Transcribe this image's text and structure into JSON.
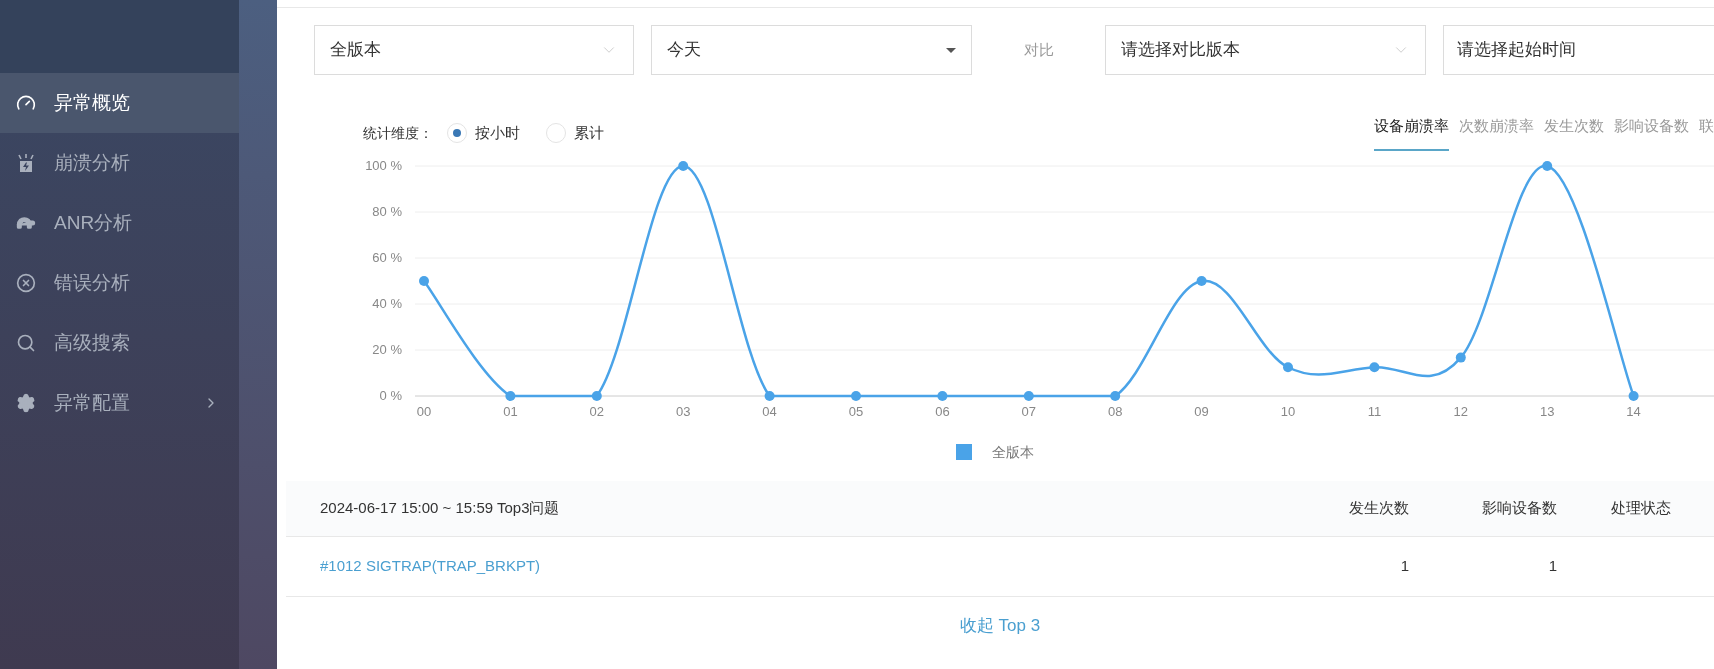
{
  "sidebar": {
    "items": [
      {
        "label": "异常概览",
        "selected": true,
        "has_submenu": false
      },
      {
        "label": "崩溃分析",
        "selected": false,
        "has_submenu": false
      },
      {
        "label": "ANR分析",
        "selected": false,
        "has_submenu": false
      },
      {
        "label": "错误分析",
        "selected": false,
        "has_submenu": false
      },
      {
        "label": "高级搜索",
        "selected": false,
        "has_submenu": false
      },
      {
        "label": "异常配置",
        "selected": false,
        "has_submenu": true
      }
    ]
  },
  "filters": {
    "version": {
      "value": "全版本"
    },
    "period": {
      "value": "今天"
    },
    "compare_label": "对比",
    "compare_version": {
      "placeholder": "请选择对比版本"
    },
    "start_time": {
      "placeholder": "请选择起始时间"
    }
  },
  "dimension": {
    "label": "统计维度：",
    "options": [
      {
        "label": "按小时",
        "selected": true
      },
      {
        "label": "累计",
        "selected": false
      }
    ]
  },
  "metric_tabs": [
    {
      "label": "设备崩溃率",
      "selected": true
    },
    {
      "label": "次数崩溃率",
      "selected": false
    },
    {
      "label": "发生次数",
      "selected": false
    },
    {
      "label": "影响设备数",
      "selected": false
    },
    {
      "label": "联",
      "selected": false
    }
  ],
  "chart_data": {
    "type": "line",
    "categories": [
      "00",
      "01",
      "02",
      "03",
      "04",
      "05",
      "06",
      "07",
      "08",
      "09",
      "10",
      "11",
      "12",
      "13",
      "14"
    ],
    "grid": true,
    "series": [
      {
        "name": "全版本",
        "color": "#4aa3e8",
        "marker": true,
        "values": [
          50,
          0,
          0,
          100,
          0,
          0,
          0,
          0,
          0,
          50,
          12.5,
          12.5,
          16.7,
          100,
          0
        ]
      }
    ],
    "ylim": [
      0,
      100
    ],
    "yticks": [
      {
        "value": 0,
        "label": "0 %"
      },
      {
        "value": 20,
        "label": "20 %"
      },
      {
        "value": 40,
        "label": "40 %"
      },
      {
        "value": 60,
        "label": "60 %"
      },
      {
        "value": 80,
        "label": "80 %"
      },
      {
        "value": 100,
        "label": "100 %"
      }
    ]
  },
  "top_issues": {
    "title": "2024-06-17 15:00 ~ 15:59 Top3问题",
    "columns": [
      "发生次数",
      "影响设备数",
      "处理状态"
    ],
    "rows": [
      {
        "issue": "#1012 SIGTRAP(TRAP_BRKPT)",
        "occurrences": "1",
        "devices": "1"
      }
    ],
    "collapse_link": "收起 Top 3"
  }
}
